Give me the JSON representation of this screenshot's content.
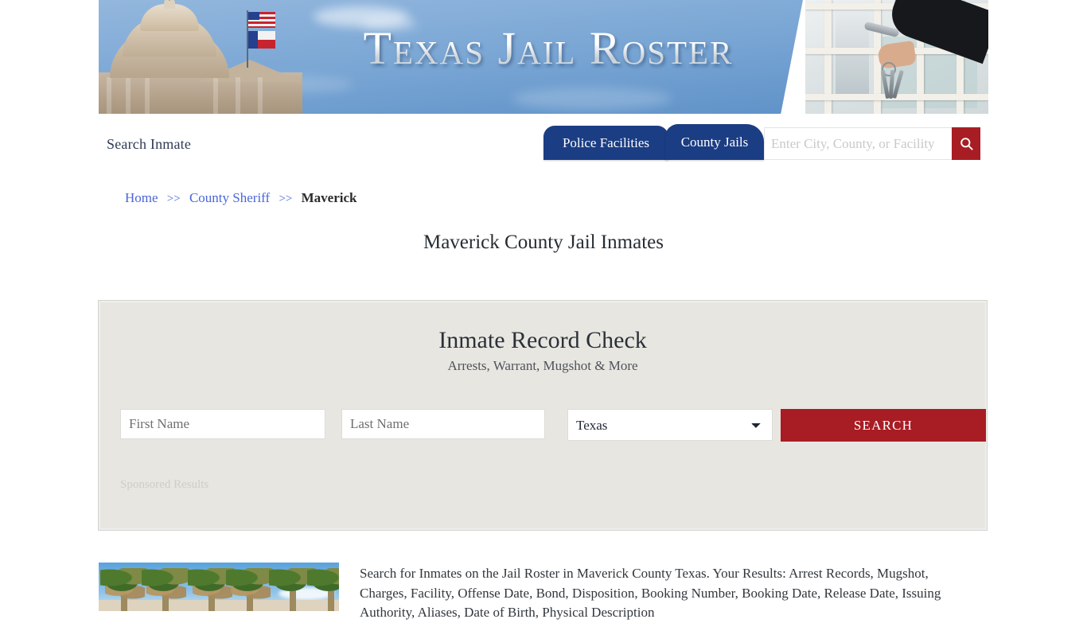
{
  "banner": {
    "title": "Texas Jail Roster",
    "left_photo": "texas-capitol-photo",
    "right_photo": "jail-cell-door-keys-photo"
  },
  "nav": {
    "brand": "Search Inmate",
    "tabs": [
      {
        "label": "Police Facilities",
        "name": "tab-police-facilities",
        "active": false
      },
      {
        "label": "County Jails",
        "name": "tab-county-jails",
        "active": true
      }
    ],
    "search": {
      "placeholder": "Enter City, County, or Facility",
      "value": "",
      "button_icon": "search-icon"
    }
  },
  "breadcrumb": {
    "items": [
      {
        "label": "Home",
        "link": true
      },
      {
        "label": "County Sheriff",
        "link": true
      },
      {
        "label": "Maverick",
        "link": false
      }
    ],
    "separator": ">>"
  },
  "page_title": "Maverick County Jail Inmates",
  "record_check": {
    "title": "Inmate Record Check",
    "subtitle": "Arrests, Warrant, Mugshot & More",
    "first_name_placeholder": "First Name",
    "first_name_value": "",
    "last_name_placeholder": "Last Name",
    "last_name_value": "",
    "state_selected": "Texas",
    "state_options": [
      "Texas"
    ],
    "search_button": "SEARCH",
    "sponsored_label": "Sponsored Results"
  },
  "content": {
    "thumbnail": "palm-trees-photo",
    "paragraph": "Search for Inmates on the Jail Roster in Maverick County Texas. Your Results: Arrest Records, Mugshot, Charges, Facility, Offense Date, Bond, Disposition, Booking Number, Booking Date, Release Date, Issuing Authority, Aliases, Date of Birth, Physical Description"
  },
  "colors": {
    "navy": "#1b3d83",
    "red": "#a81c24",
    "link": "#4a66d8",
    "card_bg": "#e8e6e1"
  }
}
